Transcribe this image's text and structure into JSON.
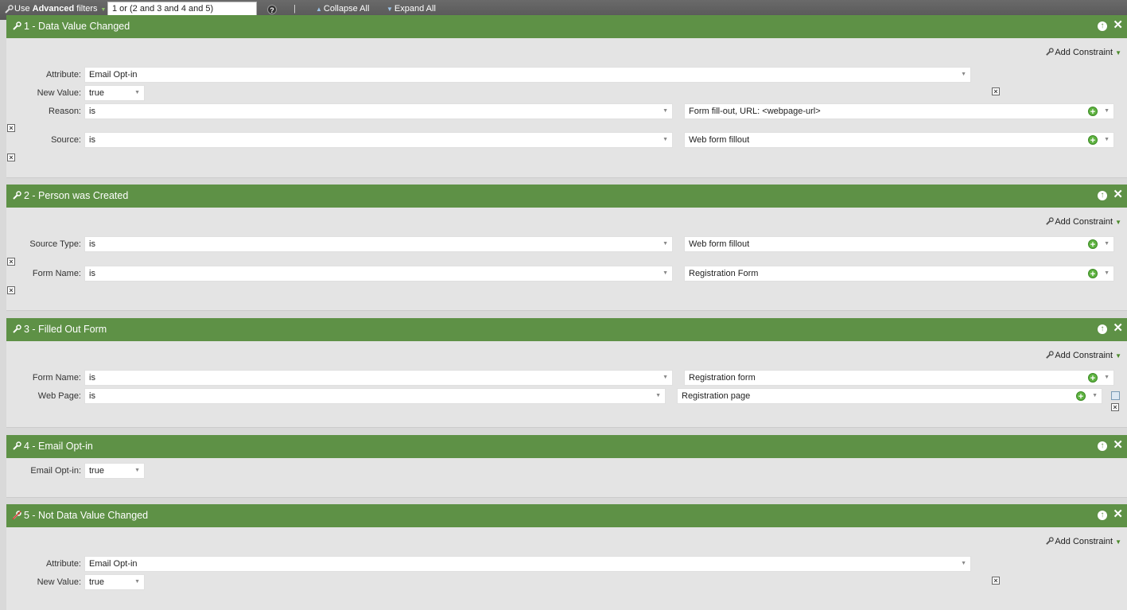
{
  "toolbar": {
    "use_prefix": "Use ",
    "advanced": "Advanced",
    "filters": " filters",
    "advanced_value": "1 or (2 and 3 and 4 and 5)",
    "help_icon": "?",
    "separator": "|",
    "collapse_all": "Collapse All",
    "expand_all": "Expand All"
  },
  "common": {
    "add_constraint": "Add Constraint"
  },
  "filters": [
    {
      "title": "1 - Data Value Changed",
      "attribute_label": "Attribute:",
      "attribute_value": "Email Opt-in",
      "newvalue_label": "New Value:",
      "newvalue_value": "true",
      "constraints": [
        {
          "label": "Reason:",
          "op": "is",
          "value": "Form fill-out, URL: <webpage-url>"
        },
        {
          "label": "Source:",
          "op": "is",
          "value": "Web form fillout"
        }
      ]
    },
    {
      "title": "2 - Person was Created",
      "constraints": [
        {
          "label": "Source Type:",
          "op": "is",
          "value": "Web form fillout"
        },
        {
          "label": "Form Name:",
          "op": "is",
          "value": "Registration Form"
        }
      ]
    },
    {
      "title": "3 - Filled Out Form",
      "constraints": [
        {
          "label": "Form Name:",
          "op": "is",
          "value": "Registration form"
        },
        {
          "label": "Web Page:",
          "op": "is",
          "value": "Registration page"
        }
      ]
    },
    {
      "title": "4 - Email Opt-in",
      "field_label": "Email Opt-in:",
      "field_value": "true"
    },
    {
      "title": "5 - Not Data Value Changed",
      "attribute_label": "Attribute:",
      "attribute_value": "Email Opt-in",
      "newvalue_label": "New Value:",
      "newvalue_value": "true"
    }
  ]
}
